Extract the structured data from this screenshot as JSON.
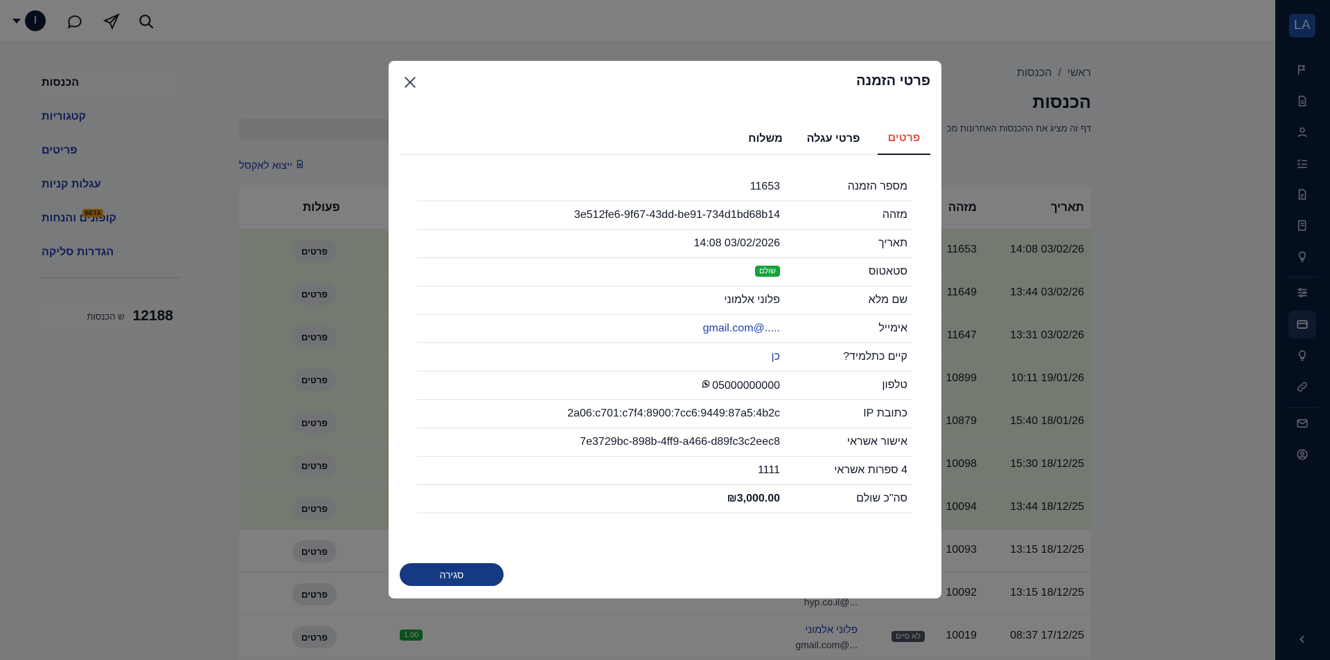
{
  "topbar": {
    "user_initial": "I"
  },
  "rail": {
    "logo": "LA"
  },
  "sidebar": {
    "items": [
      {
        "label": "הכנסות",
        "active": true
      },
      {
        "label": "קטגוריות"
      },
      {
        "label": "פריטים"
      },
      {
        "label": "עגלות קניות"
      },
      {
        "label": "קופונים והנחות",
        "badge": "BETA"
      },
      {
        "label": "הגדרות סליקה"
      }
    ],
    "stat": {
      "number": "12188",
      "label": "ש הכנסות"
    }
  },
  "main": {
    "breadcrumb": {
      "home": "ראשי",
      "sep": "/",
      "current": "הכנסות"
    },
    "title": "הכנסות",
    "description": "דף זה מציג את ההכנסות האחרונות מכ",
    "export_label": "ייצוא לאקסל",
    "columns": {
      "date": "תאריך",
      "id": "מזהה",
      "actions": "פעולות"
    },
    "details_btn": "פרטים",
    "rows": [
      {
        "date": "14:08 03/02/26",
        "id": "11653",
        "paid": true
      },
      {
        "date": "13:44 03/02/26",
        "id": "11649",
        "paid": true
      },
      {
        "date": "13:31 03/02/26",
        "id": "11647",
        "paid": true
      },
      {
        "date": "10:11 19/01/26",
        "id": "10899",
        "paid": true
      },
      {
        "date": "15:40 18/01/26",
        "id": "10879",
        "paid": true
      },
      {
        "date": "15:30 18/12/25",
        "id": "10098",
        "paid": true
      },
      {
        "date": "13:44 18/12/25",
        "id": "10094",
        "paid": true
      },
      {
        "date": "13:15 18/12/25",
        "id": "10093",
        "paid": false
      },
      {
        "date": "13:15 18/12/25",
        "id": "10092",
        "paid": false,
        "email": "hyp.co.il@..."
      },
      {
        "date": "08:37 17/12/25",
        "id": "10019",
        "paid": false,
        "badge": "לא סיים",
        "name": "פלוני אלמוני",
        "email": "gmail.com@...",
        "amount": "1.00"
      }
    ]
  },
  "modal": {
    "title": "פרטי הזמנה",
    "tabs": [
      "פרטים",
      "פרטי עגלה",
      "משלוח"
    ],
    "fields": [
      {
        "label": "מספר הזמנה",
        "value": "11653"
      },
      {
        "label": "מזהה",
        "value": "3e512fe6-9f67-43dd-be91-734d1bd68b14"
      },
      {
        "label": "תאריך",
        "value": "14:08 03/02/2026"
      },
      {
        "label": "סטאטוס",
        "badge": "שולם"
      },
      {
        "label": "שם מלא",
        "value": "פלוני אלמוני"
      },
      {
        "label": "אימייל",
        "value": "gmail.com@.....",
        "link": true
      },
      {
        "label": "קיים כתלמיד?",
        "value": "כן",
        "link": true
      },
      {
        "label": "טלפון",
        "value": "05000000000",
        "whatsapp": true
      },
      {
        "label": "כתובת IP",
        "value": "2a06:c701:c7f4:8900:7cc6:9449:87a5:4b2c"
      },
      {
        "label": "אישור אשראי",
        "value": "7e3729bc-898b-4ff9-a466-d89fc3c2eec8"
      },
      {
        "label": "4 ספרות אשראי",
        "value": "1111"
      },
      {
        "label": "סה\"כ שולם",
        "value": "₪3,000.00",
        "bold": true
      }
    ],
    "close_label": "סגירה"
  }
}
